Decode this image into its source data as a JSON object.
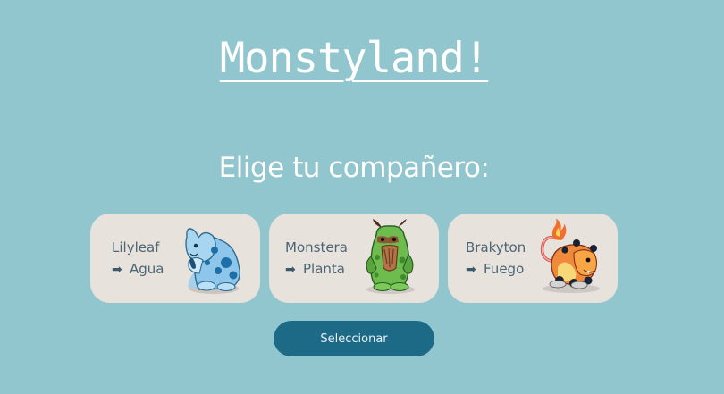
{
  "header": {
    "title": "Monstyland!",
    "subtitle": "Elige tu compañero:"
  },
  "cards": [
    {
      "name": "Lilyleaf",
      "arrow": "➡",
      "type": "Agua",
      "icon": "water-monster-icon",
      "color": "#7bb6df"
    },
    {
      "name": "Monstera",
      "arrow": "➡",
      "type": "Planta",
      "icon": "plant-monster-icon",
      "color": "#7dc35c"
    },
    {
      "name": "Brakyton",
      "arrow": "➡",
      "type": "Fuego",
      "icon": "fire-monster-icon",
      "color": "#f08a3a"
    }
  ],
  "actions": {
    "select_label": "Seleccionar"
  },
  "colors": {
    "background": "#92c6cf",
    "card": "#e8e2dd",
    "button": "#1d6a87",
    "text_muted": "#4a6574"
  }
}
